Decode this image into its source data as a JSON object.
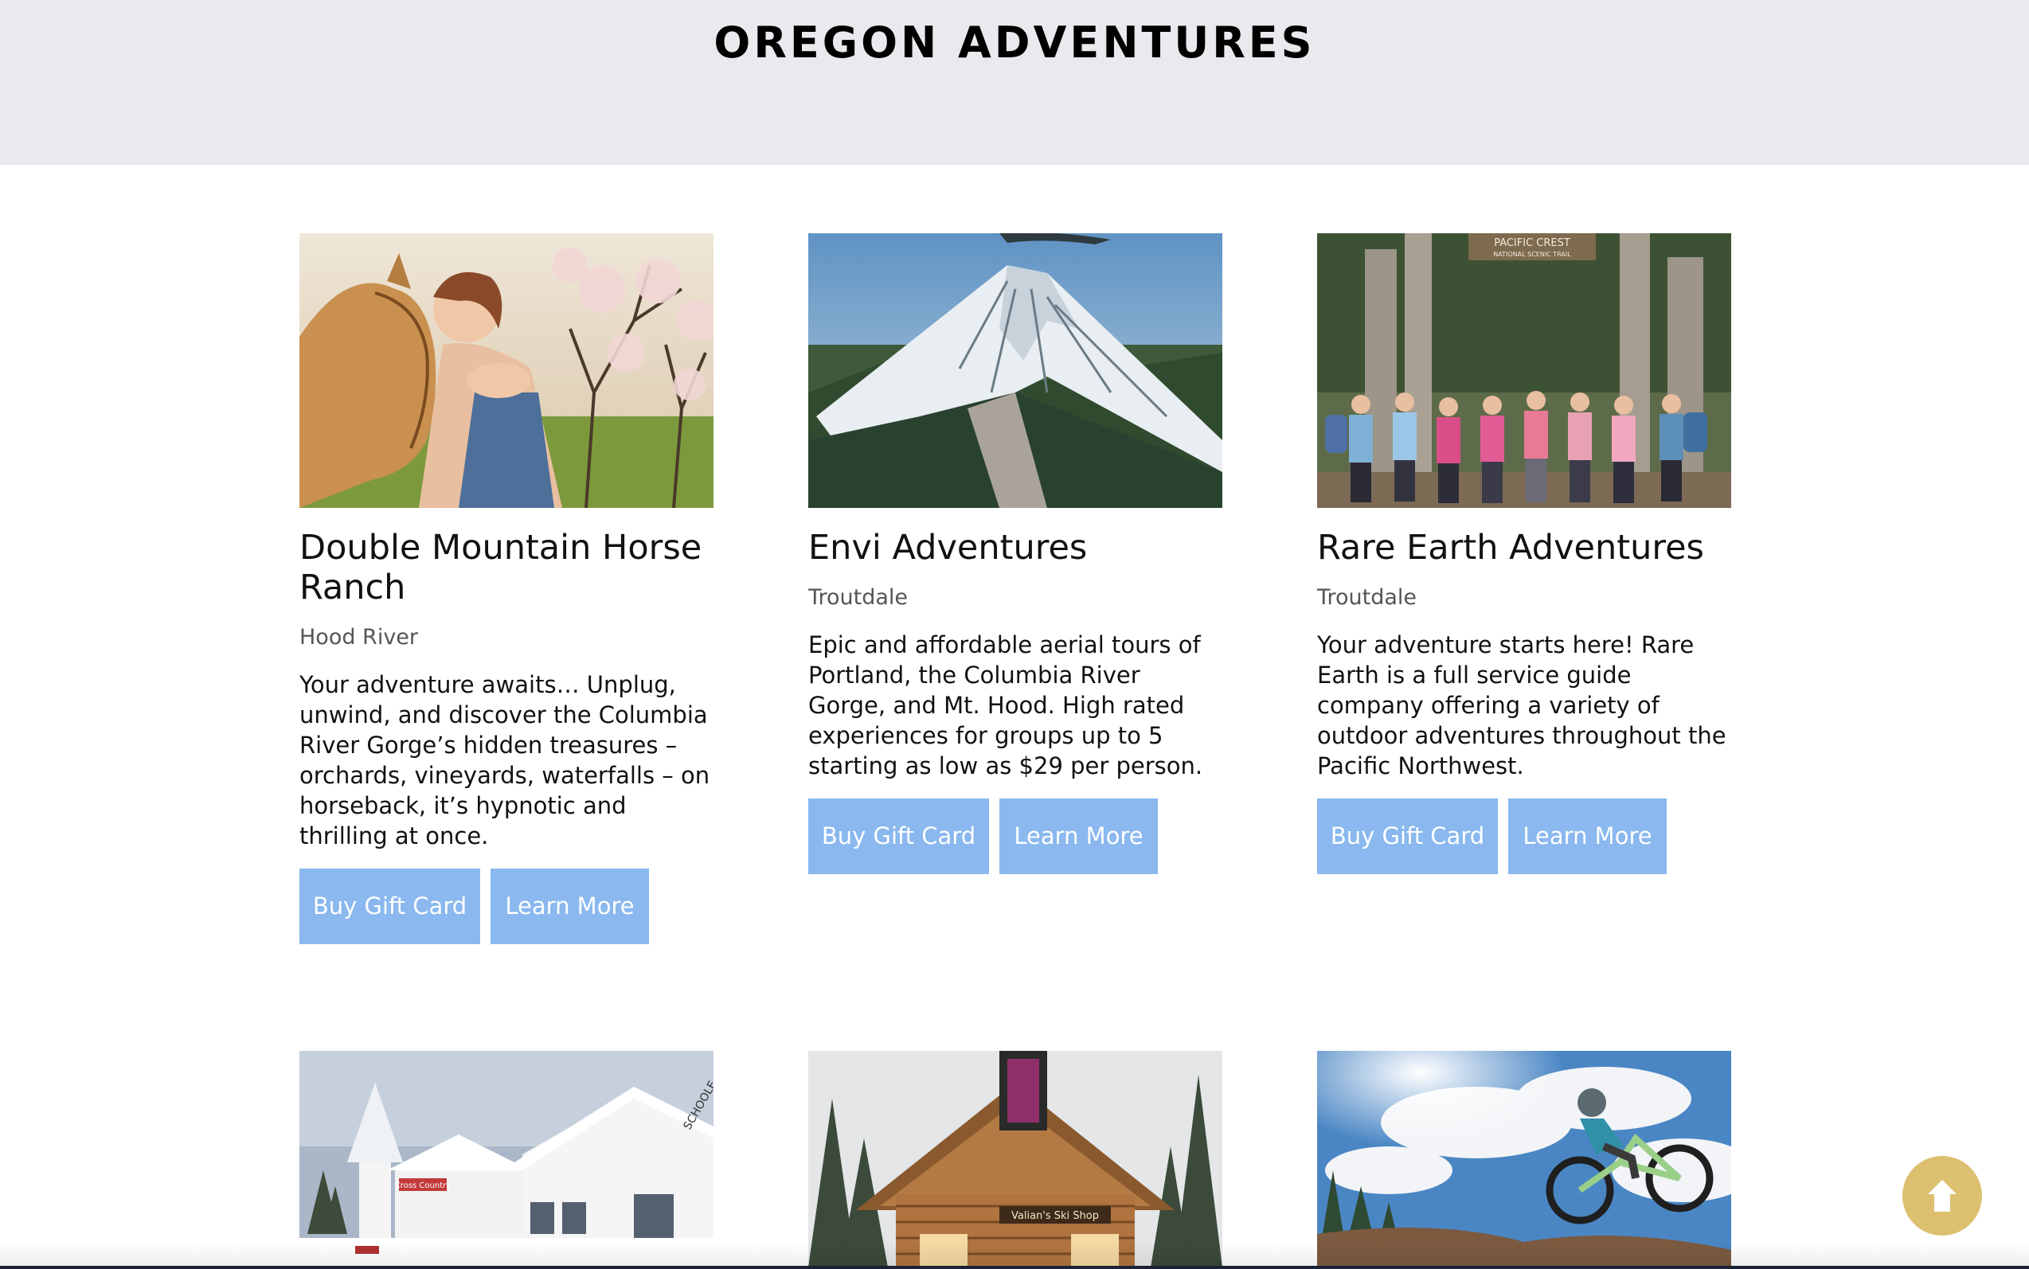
{
  "page": {
    "title": "OREGON ADVENTURES"
  },
  "colors": {
    "header_bg": "#e9e9ee",
    "button_bg": "#8ab8ef",
    "button_text": "#ffffff",
    "scroll_top_bg": "#dcc06f"
  },
  "cards": [
    {
      "title": "Double Mountain Horse Ranch",
      "location": "Hood River",
      "description": "Your adventure awaits… Unplug, unwind, and discover the Columbia River Gorge’s hidden treasures – orchards, vineyards, waterfalls – on horseback, it’s hypnotic and thrilling at once.",
      "buttons": {
        "gift": "Buy Gift Card",
        "learn": "Learn More"
      }
    },
    {
      "title": "Envi Adventures",
      "location": "Troutdale",
      "description": "Epic and affordable aerial tours of Portland, the Columbia River Gorge, and Mt. Hood. High rated experiences for groups up to 5 starting as low as $29 per person.",
      "buttons": {
        "gift": "Buy Gift Card",
        "learn": "Learn More"
      }
    },
    {
      "title": "Rare Earth Adventures",
      "location": "Troutdale",
      "description": "Your adventure starts here! Rare Earth is a full service guide company offering a variety of outdoor adventures throughout the Pacific Northwest.",
      "buttons": {
        "gift": "Buy Gift Card",
        "learn": "Learn More"
      }
    }
  ],
  "image_signs": {
    "pacific_crest": "PACIFIC CREST",
    "pacific_crest_sub": "NATIONAL SCENIC TRAIL",
    "cross_country": "Cross Country",
    "schoolhouse": "SCHOOLE",
    "ski_shop": "Valian's Ski Shop"
  },
  "icons": {
    "scroll_top": "arrow-up-icon"
  }
}
